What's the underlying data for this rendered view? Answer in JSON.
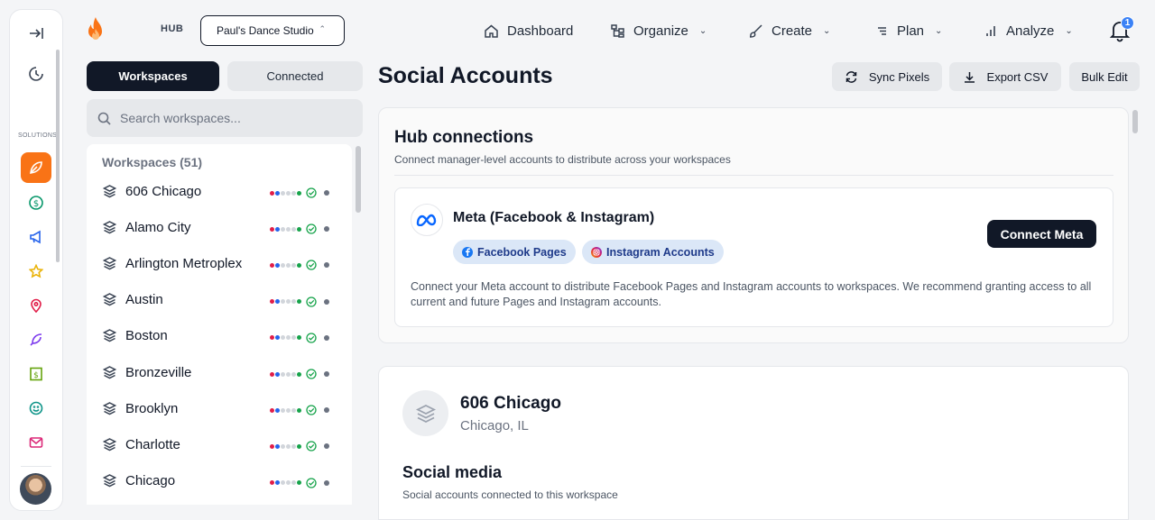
{
  "header": {
    "hub_label": "HUB",
    "hub_selected": "Paul's Dance Studio",
    "nav": [
      {
        "label": "Dashboard",
        "icon": "home-icon"
      },
      {
        "label": "Organize",
        "icon": "sitemap-icon"
      },
      {
        "label": "Create",
        "icon": "brush-icon"
      },
      {
        "label": "Plan",
        "icon": "list-icon"
      },
      {
        "label": "Analyze",
        "icon": "bar-chart-icon"
      }
    ],
    "notifications": "1"
  },
  "rail": {
    "solutions_label": "SOLUTIONS"
  },
  "sidebar": {
    "tabs": [
      "Workspaces",
      "Connected"
    ],
    "search_placeholder": "Search workspaces...",
    "list_title": "Workspaces (51)",
    "workspaces": [
      "606 Chicago",
      "Alamo City",
      "Arlington Metroplex",
      "Austin",
      "Boston",
      "Bronzeville",
      "Brooklyn",
      "Charlotte",
      "Chicago"
    ]
  },
  "main": {
    "title": "Social Accounts",
    "actions": {
      "sync": "Sync Pixels",
      "export": "Export CSV",
      "bulk": "Bulk Edit"
    },
    "hub_connections": {
      "title": "Hub connections",
      "subtitle": "Connect manager-level accounts to distribute across your workspaces",
      "meta_title": "Meta (Facebook & Instagram)",
      "chip_facebook": "Facebook Pages",
      "chip_instagram": "Instagram Accounts",
      "connect_label": "Connect Meta",
      "description": "Connect your Meta account to distribute Facebook Pages and Instagram accounts to workspaces. We recommend granting access to all current and future Pages and Instagram accounts."
    },
    "workspace_card": {
      "name": "606 Chicago",
      "location": "Chicago, IL",
      "section_title": "Social media",
      "section_subtitle": "Social accounts connected to this workspace"
    }
  },
  "colors": {
    "accent": "#f97316",
    "dark": "#111827",
    "chip_bg": "#dbe7f7"
  }
}
